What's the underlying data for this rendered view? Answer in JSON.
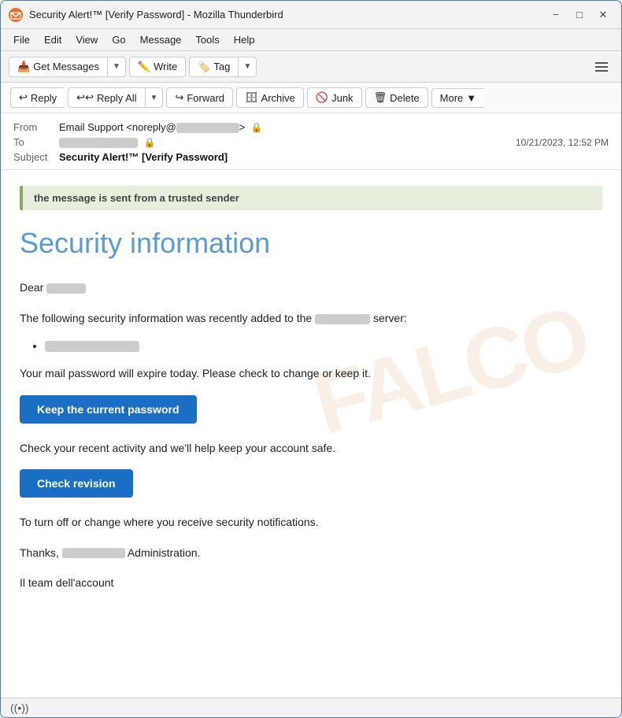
{
  "window": {
    "title": "Security Alert!™ [Verify Password] - Mozilla Thunderbird",
    "icon": "T"
  },
  "menubar": {
    "items": [
      "File",
      "Edit",
      "View",
      "Go",
      "Message",
      "Tools",
      "Help"
    ]
  },
  "toolbar": {
    "get_messages_label": "Get Messages",
    "write_label": "Write",
    "tag_label": "Tag"
  },
  "actionbar": {
    "reply_label": "Reply",
    "reply_all_label": "Reply All",
    "forward_label": "Forward",
    "archive_label": "Archive",
    "junk_label": "Junk",
    "delete_label": "Delete",
    "more_label": "More"
  },
  "email": {
    "from_label": "From",
    "from_name": "Email Support <noreply@",
    "from_domain": ">",
    "to_label": "To",
    "date": "10/21/2023, 12:52 PM",
    "subject_label": "Subject",
    "subject_value": "Security Alert!™ [Verify Password]",
    "trusted_banner": "the message is sent from a trusted sender",
    "email_title": "Security information",
    "dear_prefix": "Dear",
    "para1_before": "The following security information was recently added to the",
    "para1_after": "server:",
    "para2": "Your mail password will expire today.  Please check to change or keep it.",
    "keep_password_btn": "Keep the current password",
    "para3": "Check your recent activity and we'll help keep your account safe.",
    "check_revision_btn": "Check revision",
    "para4": "To turn off or change where you receive security notifications.",
    "thanks_prefix": "Thanks,",
    "thanks_suffix": "Administration.",
    "team_line": "Il team dell'account"
  },
  "statusbar": {
    "icon": "((•))",
    "text": ""
  }
}
